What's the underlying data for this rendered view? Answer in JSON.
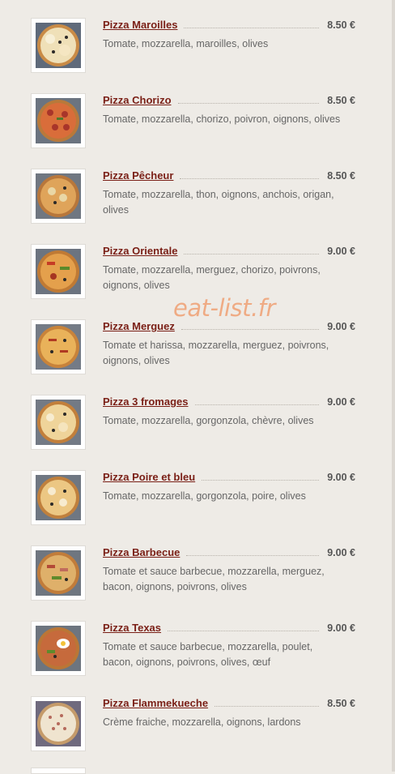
{
  "watermark": "eat-list.fr",
  "menu": {
    "items": [
      {
        "name": "Pizza Maroilles",
        "price": "8.50 €",
        "desc": "Tomate, mozzarella, maroilles, olives",
        "image": "pizza-photo"
      },
      {
        "name": "Pizza Chorizo",
        "price": "8.50 €",
        "desc": "Tomate, mozzarella, chorizo, poivron, oignons, olives",
        "image": "pizza-photo"
      },
      {
        "name": "Pizza Pêcheur",
        "price": "8.50 €",
        "desc": "Tomate, mozzarella, thon, oignons, anchois, origan, olives",
        "image": "pizza-photo"
      },
      {
        "name": "Pizza Orientale",
        "price": "9.00 €",
        "desc": "Tomate, mozzarella, merguez, chorizo, poivrons, oignons, olives",
        "image": "pizza-photo"
      },
      {
        "name": "Pizza Merguez",
        "price": "9.00 €",
        "desc": "Tomate et harissa, mozzarella, merguez, poivrons, oignons, olives",
        "image": "pizza-photo"
      },
      {
        "name": "Pizza 3 fromages",
        "price": "9.00 €",
        "desc": "Tomate, mozzarella, gorgonzola, chèvre, olives",
        "image": "pizza-photo"
      },
      {
        "name": "Pizza Poire et bleu",
        "price": "9.00 €",
        "desc": "Tomate, mozzarella, gorgonzola, poire, olives",
        "image": "pizza-photo"
      },
      {
        "name": "Pizza Barbecue",
        "price": "9.00 €",
        "desc": "Tomate et sauce barbecue, mozzarella, merguez, bacon, oignons, poivrons, olives",
        "image": "pizza-photo"
      },
      {
        "name": "Pizza Texas",
        "price": "9.00 €",
        "desc": "Tomate et sauce barbecue, mozzarella, poulet, bacon, oignons, poivrons, olives, œuf",
        "image": "pizza-photo"
      },
      {
        "name": "Pizza Flammekueche",
        "price": "8.50 €",
        "desc": "Crème fraiche, mozzarella, oignons, lardons",
        "image": "pizza-photo"
      }
    ]
  },
  "colors": {
    "background": "#eeebe6",
    "title": "#7a1f16",
    "text": "#666666",
    "watermark": "#f0a57a"
  }
}
